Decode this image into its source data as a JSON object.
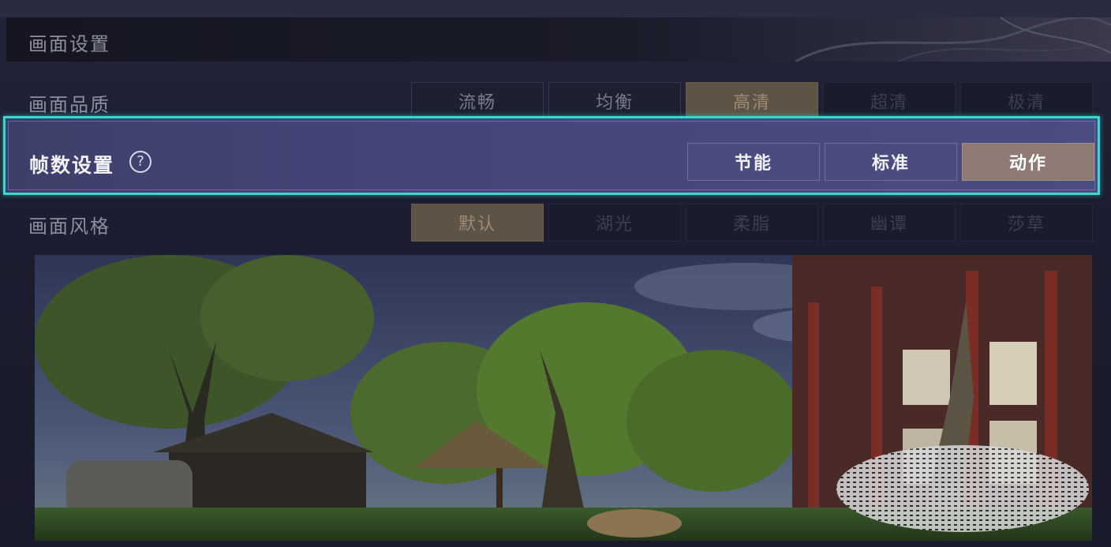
{
  "header": {
    "title": "画面设置"
  },
  "quality": {
    "label": "画面品质",
    "options": [
      "流畅",
      "均衡",
      "高清",
      "超清",
      "极清"
    ]
  },
  "fps": {
    "label": "帧数设置",
    "help": "?",
    "options": [
      "节能",
      "标准",
      "动作"
    ],
    "selected": "动作"
  },
  "style": {
    "label": "画面风格",
    "options": [
      "默认",
      "湖光",
      "柔脂",
      "幽谭",
      "莎草"
    ]
  },
  "colors": {
    "highlight": "#38d7cf",
    "selected": "#8f7a74",
    "panel": "#44467a"
  },
  "icons": {
    "help": "question-circle-icon"
  }
}
